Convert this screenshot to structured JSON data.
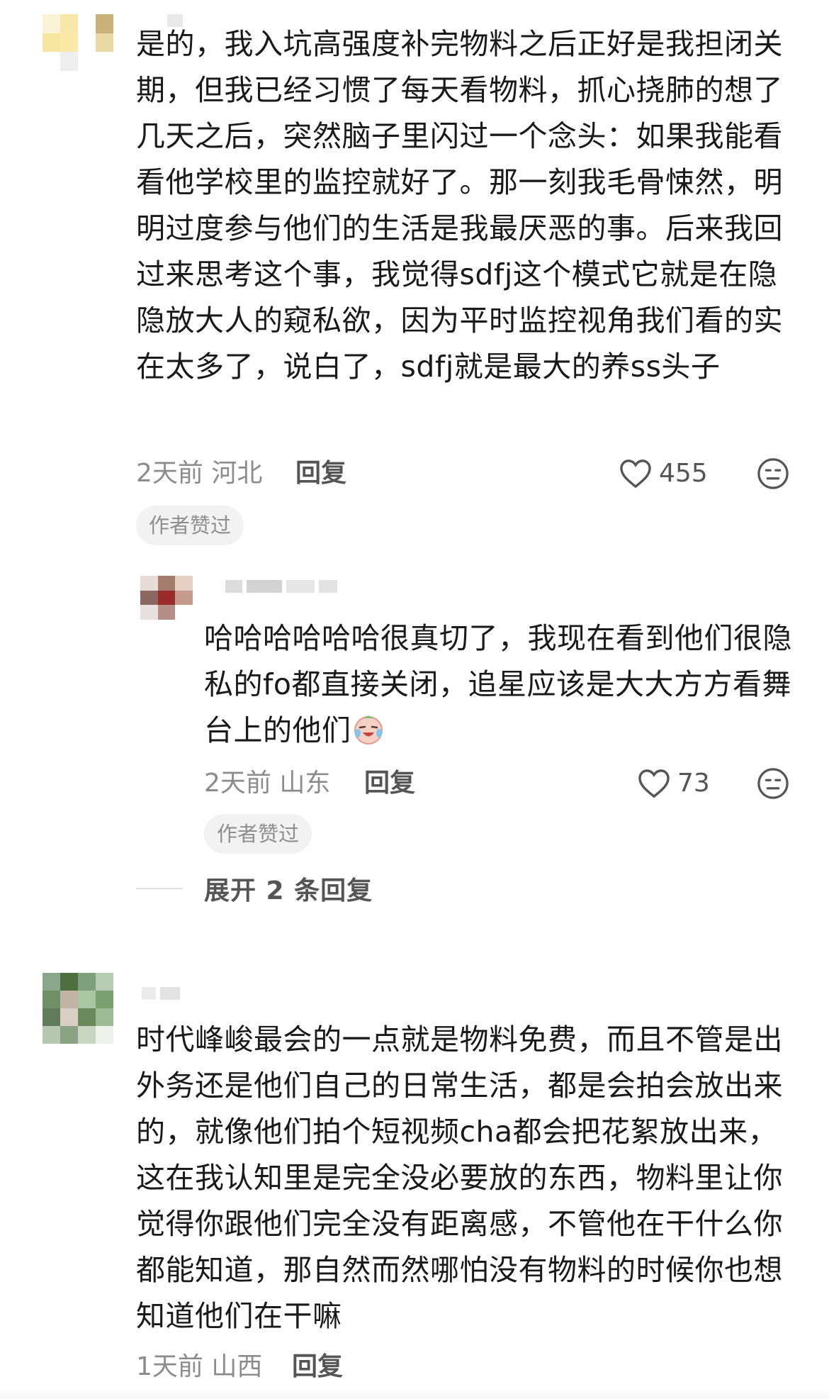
{
  "comments": [
    {
      "text": "是的，我入坑高强度补完物料之后正好是我担闭关期，但我已经习惯了每天看物料，抓心挠肺的想了几天之后，突然脑子里闪过一个念头：如果我能看看他学校里的监控就好了。那一刻我毛骨悚然，明明过度参与他们的生活是我最厌恶的事。后来我回过来思考这个事，我觉得sdfj这个模式它就是在隐隐放大人的窥私欲，因为平时监控视角我们看的实在太多了，说白了，sdfj就是最大的养ss头子",
      "time": "2天前 河北",
      "reply_label": "回复",
      "likes": "455",
      "badge": "作者赞过",
      "reply": {
        "text": "哈哈哈哈哈哈很真切了，我现在看到他们很隐私的fo都直接关闭，追星应该是大大方方看舞台上的他们",
        "emoji_icon": "crying-laughing-face-icon",
        "time": "2天前 山东",
        "reply_label": "回复",
        "likes": "73",
        "badge": "作者赞过"
      },
      "expand_label": "展开 2 条回复"
    },
    {
      "text": "时代峰峻最会的一点就是物料免费，而且不管是出外务还是他们自己的日常生活，都是会拍会放出来的，就像他们拍个短视频cha都会把花絮放出来，这在我认知里是完全没必要放的东西，物料里让你觉得你跟他们完全没有距离感，不管他在干什么你都能知道，那自然而然哪怕没有物料的时候你也想知道他们在干嘛",
      "time": "1天前 山西",
      "reply_label": "回复"
    }
  ],
  "colors": {
    "text": "#1a1a1a",
    "meta": "#8c8c8c",
    "badge_bg": "#f2f2f2"
  },
  "icons": [
    "heart-outline-icon",
    "dislike-face-icon",
    "crying-laughing-face-icon"
  ]
}
